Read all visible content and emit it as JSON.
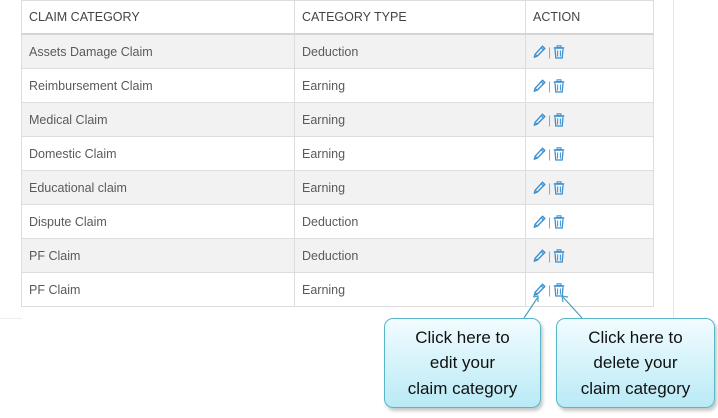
{
  "table": {
    "headers": [
      "CLAIM CATEGORY",
      "CATEGORY TYPE",
      "ACTION"
    ],
    "rows": [
      {
        "category": "Assets Damage Claim",
        "type": "Deduction"
      },
      {
        "category": "Reimbursement Claim",
        "type": "Earning"
      },
      {
        "category": "Medical Claim",
        "type": "Earning"
      },
      {
        "category": "Domestic Claim",
        "type": "Earning"
      },
      {
        "category": "Educational claim",
        "type": "Earning"
      },
      {
        "category": "Dispute Claim",
        "type": "Deduction"
      },
      {
        "category": "PF Claim",
        "type": "Deduction"
      },
      {
        "category": "PF Claim",
        "type": "Earning"
      }
    ],
    "action_separator": "|",
    "icons": {
      "edit": "pencil-icon",
      "delete": "trash-icon"
    }
  },
  "callouts": {
    "edit": "Click here  to\nedit your\nclaim category",
    "delete": "Click here  to\ndelete your\nclaim category"
  },
  "colors": {
    "icon": "#3a8fd1",
    "row_stripe": "#f2f2f2",
    "callout_border": "#58b6c8",
    "callout_fill": "#b9eaf6"
  }
}
